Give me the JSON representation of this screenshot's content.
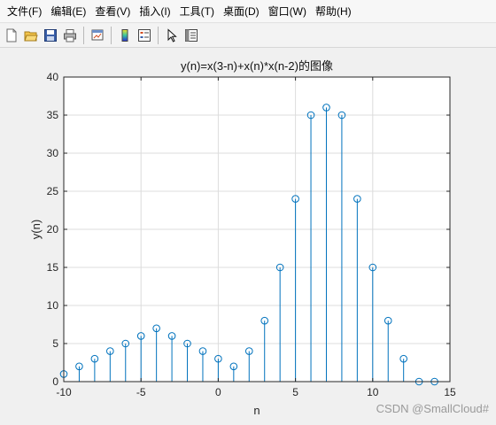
{
  "menu": [
    "文件(F)",
    "编辑(E)",
    "查看(V)",
    "插入(I)",
    "工具(T)",
    "桌面(D)",
    "窗口(W)",
    "帮助(H)"
  ],
  "toolbar": {
    "icons": [
      "new-file-icon",
      "open-folder-icon",
      "save-icon",
      "print-icon",
      "link-figure-icon",
      "insert-colorbar-icon",
      "insert-legend-icon",
      "pointer-icon",
      "property-editor-icon"
    ]
  },
  "watermark": "CSDN @SmallCloud#",
  "colors": {
    "stem": "#0072bd",
    "grid": "#dcdcdc",
    "axes": "#262626"
  },
  "chart_data": {
    "type": "stem",
    "title": "y(n)=x(3-n)+x(n)*x(n-2)的图像",
    "xlabel": "n",
    "ylabel": "y(n)",
    "xlim": [
      -10,
      15
    ],
    "ylim": [
      0,
      40
    ],
    "xticks": [
      -10,
      -5,
      0,
      5,
      10,
      15
    ],
    "yticks": [
      0,
      5,
      10,
      15,
      20,
      25,
      30,
      35,
      40
    ],
    "grid": true,
    "x": [
      -10,
      -9,
      -8,
      -7,
      -6,
      -5,
      -4,
      -3,
      -2,
      -1,
      0,
      1,
      2,
      3,
      4,
      5,
      6,
      7,
      8,
      9,
      10,
      11,
      12,
      13,
      14
    ],
    "y": [
      1,
      2,
      3,
      4,
      5,
      6,
      7,
      6,
      5,
      4,
      3,
      2,
      4,
      8,
      15,
      24,
      35,
      36,
      35,
      24,
      15,
      8,
      3,
      0,
      0
    ]
  }
}
